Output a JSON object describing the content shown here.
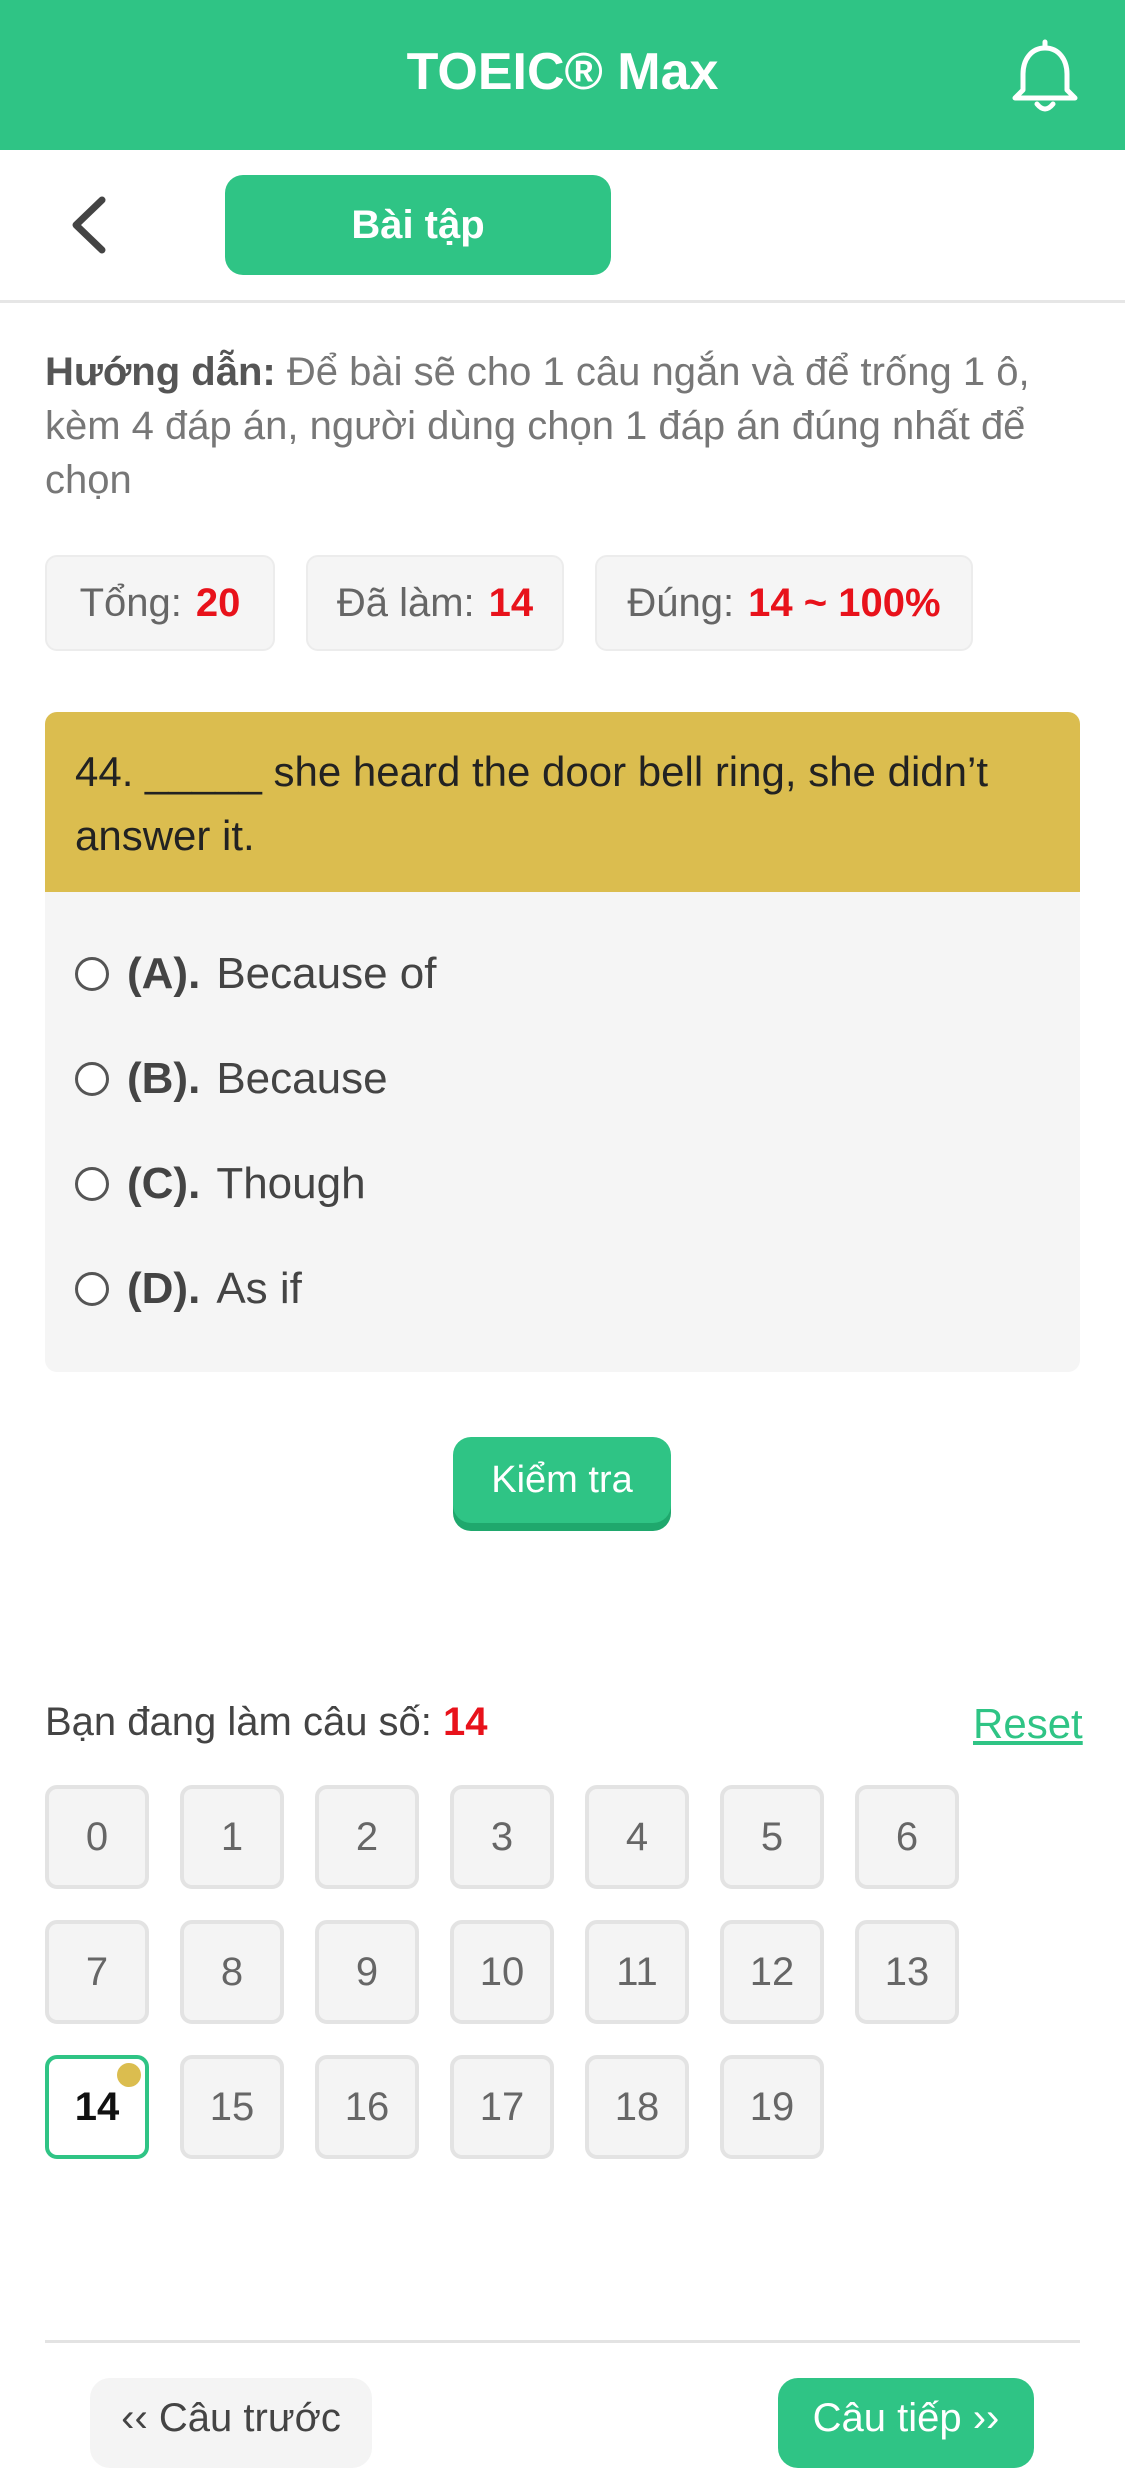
{
  "header": {
    "title": "TOEIC® Max"
  },
  "subbar": {
    "tab_label": "Bài tập"
  },
  "instruction": {
    "label": "Hướng dẫn:",
    "text": "Để bài sẽ cho 1 câu ngắn và để trống 1 ô, kèm 4 đáp án, người dùng chọn 1 đáp án đúng nhất để chọn"
  },
  "stats": {
    "total_label": "Tổng:",
    "total_value": "20",
    "done_label": "Đã làm:",
    "done_value": "14",
    "correct_label": "Đúng:",
    "correct_value": "14 ~ 100%"
  },
  "question": {
    "text": "44. _____ she heard the door bell ring, she didn’t answer it.",
    "options": [
      {
        "key": "(A).",
        "text": "Because of"
      },
      {
        "key": "(B).",
        "text": "Because"
      },
      {
        "key": "(C).",
        "text": "Though"
      },
      {
        "key": "(D).",
        "text": "As if"
      }
    ]
  },
  "check_button": "Kiểm tra",
  "progress": {
    "label": "Bạn đang làm câu số:",
    "current": "14",
    "reset": "Reset",
    "numbers": [
      "0",
      "1",
      "2",
      "3",
      "4",
      "5",
      "6",
      "7",
      "8",
      "9",
      "10",
      "11",
      "12",
      "13",
      "14",
      "15",
      "16",
      "17",
      "18",
      "19"
    ]
  },
  "footer": {
    "prev": "‹‹ Câu trước",
    "next": "Câu tiếp ››"
  },
  "colors": {
    "primary": "#2fc485",
    "question_header": "#dbbd4f",
    "accent_red": "#e8121b"
  },
  "icons": {
    "notification": "bell-icon",
    "back": "chevron-left-icon"
  }
}
